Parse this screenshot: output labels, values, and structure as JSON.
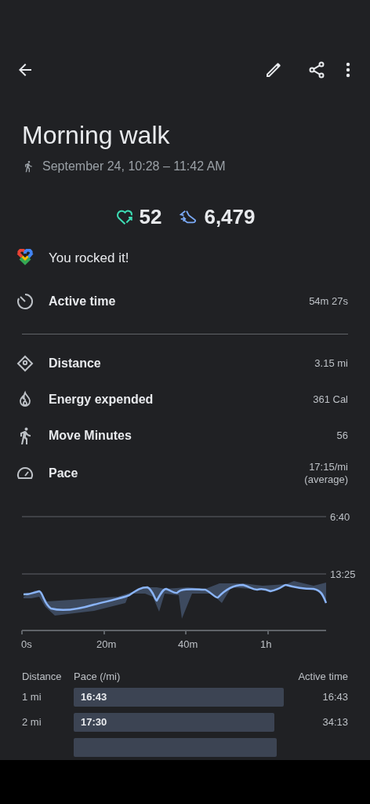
{
  "title": "Morning walk",
  "date": "September 24, 10:28 – 11:42 AM",
  "heart_points": "52",
  "steps": "6,479",
  "goal_message": "You rocked it!",
  "active_time": {
    "label": "Active time",
    "value": "54m 27s"
  },
  "metrics": [
    {
      "label": "Distance",
      "value": "3.15 mi"
    },
    {
      "label": "Energy expended",
      "value": "361 Cal"
    },
    {
      "label": "Move Minutes",
      "value": "56"
    },
    {
      "label": "Pace",
      "value": "17:15/mi",
      "note": "(average)"
    }
  ],
  "chart": {
    "y_labels": [
      "6:40",
      "13:25"
    ],
    "x_labels": [
      "0s",
      "20m",
      "40m",
      "1h"
    ]
  },
  "splits": {
    "columns": [
      "Distance",
      "Pace (/mi)",
      "Active time"
    ],
    "rows": [
      {
        "kind": "split",
        "distance": "1 mi",
        "pace": "16:43",
        "time": "16:43"
      },
      {
        "kind": "split",
        "distance": "2 mi",
        "pace": "17:30",
        "time": "34:13"
      },
      {
        "kind": "partial"
      }
    ]
  }
}
